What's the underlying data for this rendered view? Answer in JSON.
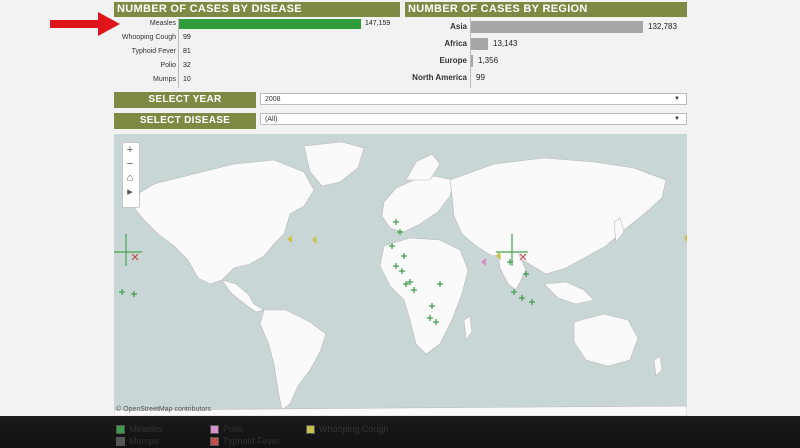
{
  "disease_panel": {
    "header": "NUMBER OF CASES BY DISEASE",
    "rows": [
      {
        "label": "Measles",
        "value": "147,159",
        "count": 147159,
        "color": "#2f9c3a"
      },
      {
        "label": "Whooping Cough",
        "value": "99",
        "count": 99,
        "color": "#2f9c3a"
      },
      {
        "label": "Typhoid Fever",
        "value": "81",
        "count": 81,
        "color": "#2f9c3a"
      },
      {
        "label": "Polio",
        "value": "32",
        "count": 32,
        "color": "#2f9c3a"
      },
      {
        "label": "Mumps",
        "value": "10",
        "count": 10,
        "color": "#2f9c3a"
      }
    ]
  },
  "region_panel": {
    "header": "NUMBER OF CASES BY REGION",
    "rows": [
      {
        "label": "Asia",
        "value": "132,783",
        "count": 132783
      },
      {
        "label": "Africa",
        "value": "13,143",
        "count": 13143
      },
      {
        "label": "Europe",
        "value": "1,356",
        "count": 1356
      },
      {
        "label": "North America",
        "value": "99",
        "count": 99
      }
    ]
  },
  "filters": {
    "year_label": "SELECT YEAR",
    "year_value": "2008",
    "disease_label": "SELECT DISEASE",
    "disease_value": "(All)",
    "arrow_glyph": "▼"
  },
  "map": {
    "zoom_in": "+",
    "zoom_out": "−",
    "home": "⌂",
    "play": "▸",
    "attribution": "© OpenStreetMap contributors"
  },
  "legend": [
    {
      "label": "Measles",
      "color": "#3e9a4c"
    },
    {
      "label": "Polio",
      "color": "#d890c8"
    },
    {
      "label": "Whooping Cough",
      "color": "#c9c24a"
    },
    {
      "label": "Mumps",
      "color": "#555555"
    },
    {
      "label": "Typhoid Fever",
      "color": "#c0504d"
    }
  ],
  "colors": {
    "header": "#7d8a44",
    "disease_bar": "#2f9c3a",
    "region_bar": "#a6a6a6",
    "annotation_arrow": "#e0141b"
  }
}
